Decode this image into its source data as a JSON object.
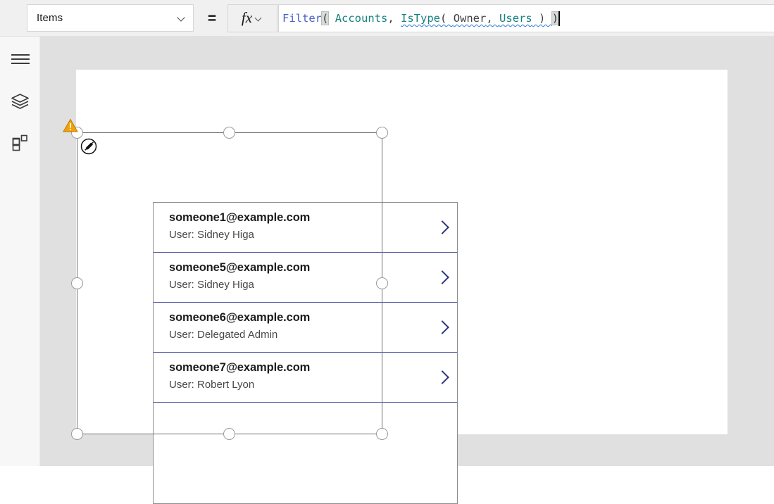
{
  "formula_bar": {
    "property_dropdown": {
      "value": "Items",
      "icon": "chevron-down-icon"
    },
    "equals_label": "=",
    "fx_button": {
      "label": "fx",
      "icon": "chevron-down-icon"
    },
    "formula_tokens": [
      {
        "text": "Filter",
        "type": "function"
      },
      {
        "text": "(",
        "type": "paren-highlight"
      },
      {
        "text": " ",
        "type": "plain"
      },
      {
        "text": "Accounts",
        "type": "table"
      },
      {
        "text": ", ",
        "type": "punct"
      },
      {
        "text": "IsType",
        "type": "table-squiggle"
      },
      {
        "text": "( ",
        "type": "punct-squiggle"
      },
      {
        "text": "Owner",
        "type": "identifier-squiggle"
      },
      {
        "text": ", ",
        "type": "punct-squiggle"
      },
      {
        "text": "Users",
        "type": "table-squiggle"
      },
      {
        "text": " ) ",
        "type": "punct-squiggle"
      },
      {
        "text": ")",
        "type": "paren-highlight"
      }
    ],
    "formula_plain_text": "Filter( Accounts, IsType( Owner, Users ) )"
  },
  "left_rail": {
    "items": [
      {
        "name": "menu",
        "icon": "hamburger-menu-icon"
      },
      {
        "name": "tree",
        "icon": "layers-tree-view-icon"
      },
      {
        "name": "insert",
        "icon": "insert-components-grid-icon"
      }
    ]
  },
  "canvas": {
    "warning_badge": {
      "icon": "warning-triangle-icon",
      "color": "#f2a10a"
    },
    "edit_pencil": {
      "icon": "edit-pencil-icon"
    },
    "gallery": {
      "rows": [
        {
          "title": "someone1@example.com",
          "subtitle": "User: Sidney Higa",
          "icon": "chevron-right-icon"
        },
        {
          "title": "someone5@example.com",
          "subtitle": "User: Sidney Higa",
          "icon": "chevron-right-icon"
        },
        {
          "title": "someone6@example.com",
          "subtitle": "User: Delegated Admin",
          "icon": "chevron-right-icon"
        },
        {
          "title": "someone7@example.com",
          "subtitle": "User: Robert Lyon",
          "icon": "chevron-right-icon"
        }
      ]
    }
  },
  "colors": {
    "accent_navy": "#2a357f",
    "row_separator": "#4d58a5",
    "warning_amber": "#f2a10a",
    "function_blue": "#4862c4",
    "table_teal": "#17807e",
    "workspace_gray": "#e0e0e0"
  }
}
